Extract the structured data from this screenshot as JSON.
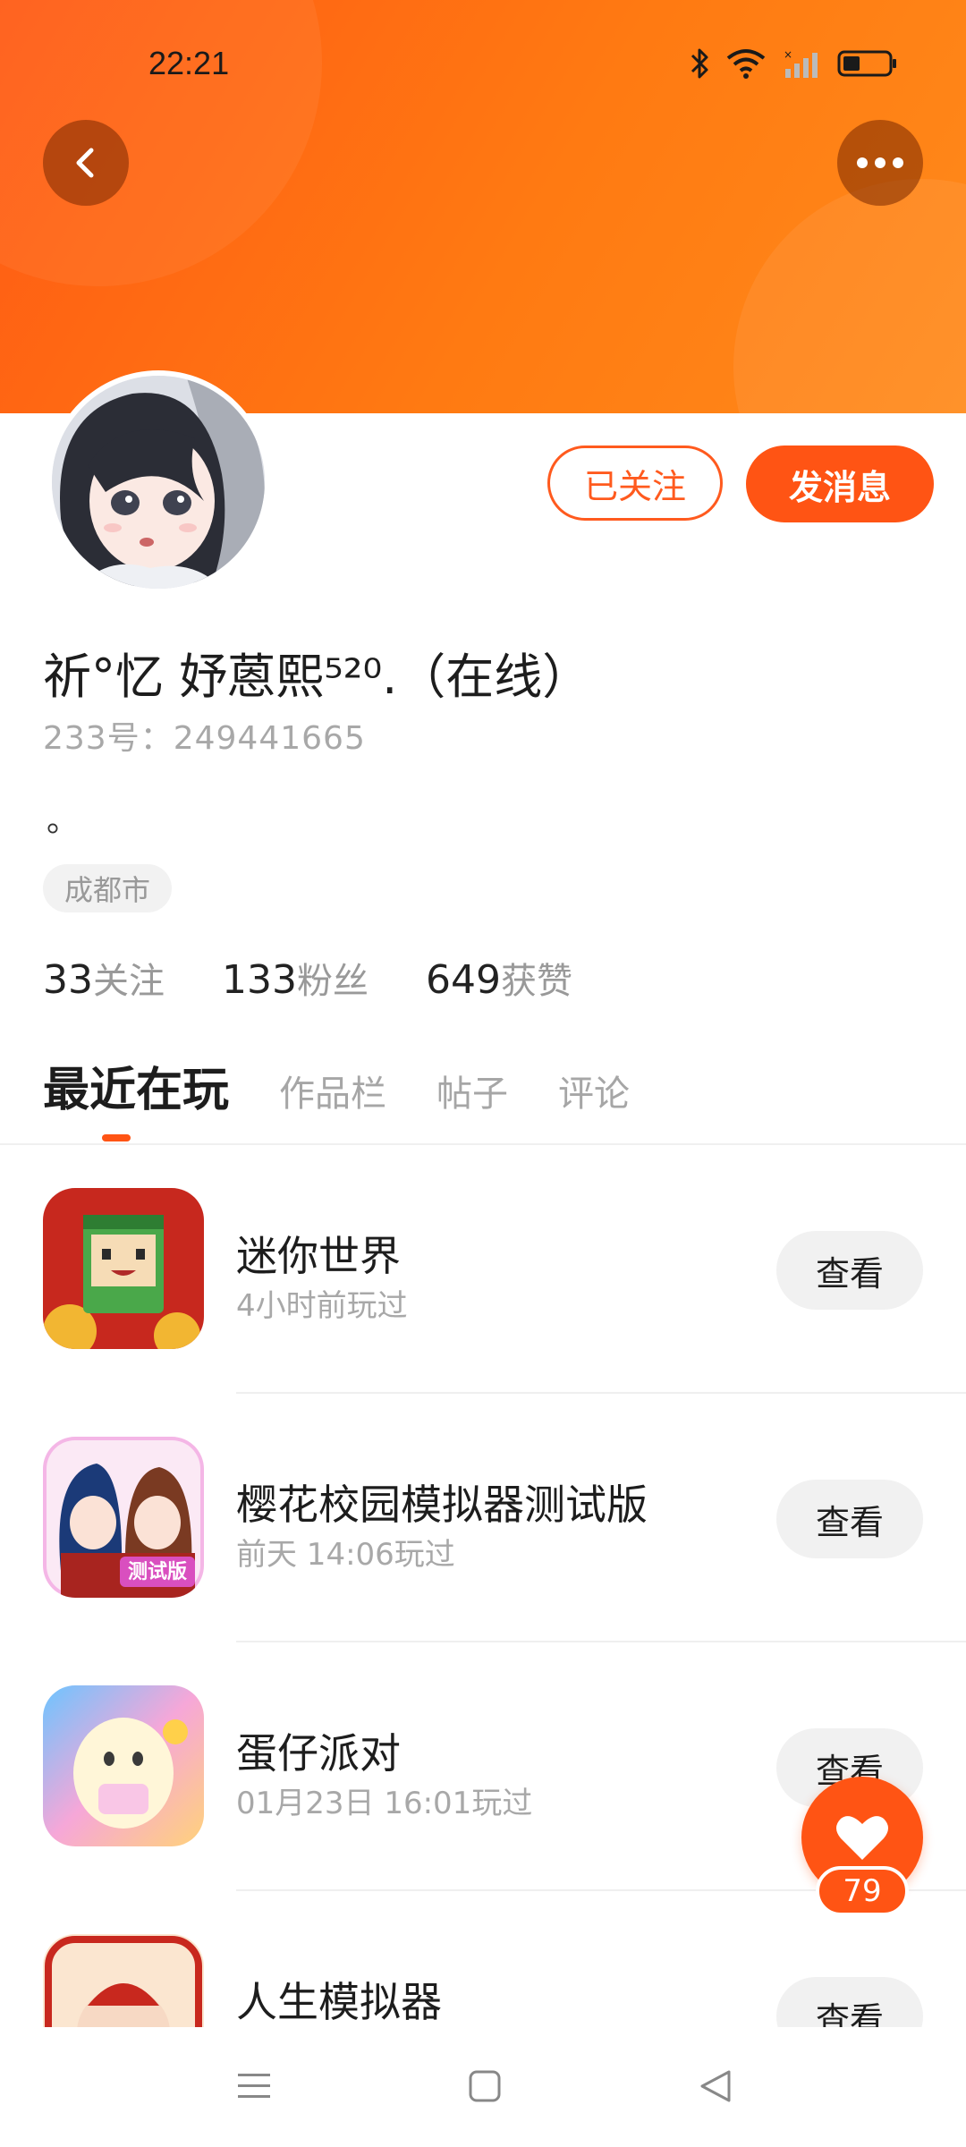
{
  "status_bar": {
    "time": "22:21"
  },
  "profile": {
    "username": "祈°忆 妤蒽熙⁵²⁰.（在线）",
    "id_text": "233号：249441665",
    "bio": "。",
    "location": "成都市",
    "follow_label": "已关注",
    "message_label": "发消息"
  },
  "stats": [
    {
      "num": "33",
      "label": "关注"
    },
    {
      "num": "133",
      "label": "粉丝"
    },
    {
      "num": "649",
      "label": "获赞"
    }
  ],
  "tabs": [
    {
      "label": "最近在玩"
    },
    {
      "label": "作品栏"
    },
    {
      "label": "帖子"
    },
    {
      "label": "评论"
    }
  ],
  "games": [
    {
      "name": "迷你世界",
      "time": "4小时前玩过",
      "action": "查看"
    },
    {
      "name": "樱花校园模拟器测试版",
      "time": "前天 14:06玩过",
      "action": "查看"
    },
    {
      "name": "蛋仔派对",
      "time": "01月23日 16:01玩过",
      "action": "查看"
    },
    {
      "name": "人生模拟器",
      "time": "",
      "action": "查看"
    }
  ],
  "game3_badge": "测试版",
  "like": {
    "count": "79"
  },
  "colors": {
    "accent": "#ff5414",
    "header": "#ff6a14"
  },
  "icons": [
    "back-arrow-icon",
    "more-icon",
    "bluetooth-icon",
    "wifi-icon",
    "signal-icon",
    "battery-icon",
    "heart-icon",
    "menu-icon",
    "home-icon",
    "back-nav-icon"
  ]
}
